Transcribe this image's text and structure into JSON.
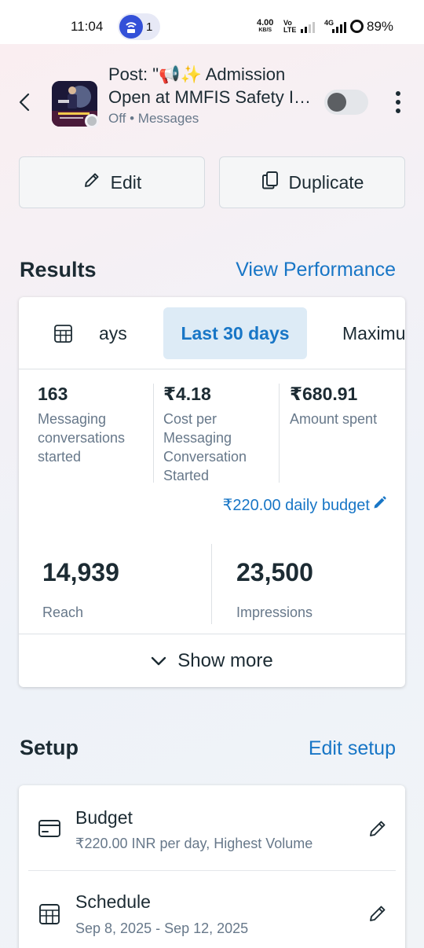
{
  "status_bar": {
    "time": "11:04",
    "notification_count": "1",
    "net_speed_value": "4.00",
    "net_speed_unit": "KB/S",
    "volte_line1": "Vo",
    "volte_line2": "LTE",
    "network_type": "4G",
    "battery": "89%"
  },
  "header": {
    "title_line1": "Post: \"📢✨ Admission",
    "title_line2": "Open at MMFIS Safety Institute",
    "status": "Off",
    "separator": "•",
    "objective": "Messages",
    "toggle_on": false
  },
  "actions": {
    "edit_label": "Edit",
    "duplicate_label": "Duplicate"
  },
  "results": {
    "title": "Results",
    "link": "View Performance",
    "tabs": [
      {
        "label": "ays",
        "active": false
      },
      {
        "label": "Last 30 days",
        "active": true
      },
      {
        "label": "Maximum",
        "active": false
      }
    ],
    "metrics": [
      {
        "value": "163",
        "label": "Messaging conversations started"
      },
      {
        "value": "₹4.18",
        "label": "Cost per Messaging Conversation Started"
      },
      {
        "value": "₹680.91",
        "label": "Amount spent"
      }
    ],
    "budget_link": "₹220.00 daily budget",
    "big_metrics": [
      {
        "value": "14,939",
        "label": "Reach"
      },
      {
        "value": "23,500",
        "label": "Impressions"
      }
    ],
    "show_more": "Show more"
  },
  "setup": {
    "title": "Setup",
    "link": "Edit setup",
    "rows": [
      {
        "title": "Budget",
        "subtitle": "₹220.00 INR per day, Highest Volume",
        "icon": "credit-card-icon"
      },
      {
        "title": "Schedule",
        "subtitle": "Sep 8, 2025 - Sep 12, 2025",
        "icon": "calendar-icon"
      }
    ]
  },
  "colors": {
    "accent": "#1876c6",
    "active_tab_bg": "#ddebf6",
    "text_primary": "#1c2b33",
    "text_secondary": "#67788a"
  }
}
